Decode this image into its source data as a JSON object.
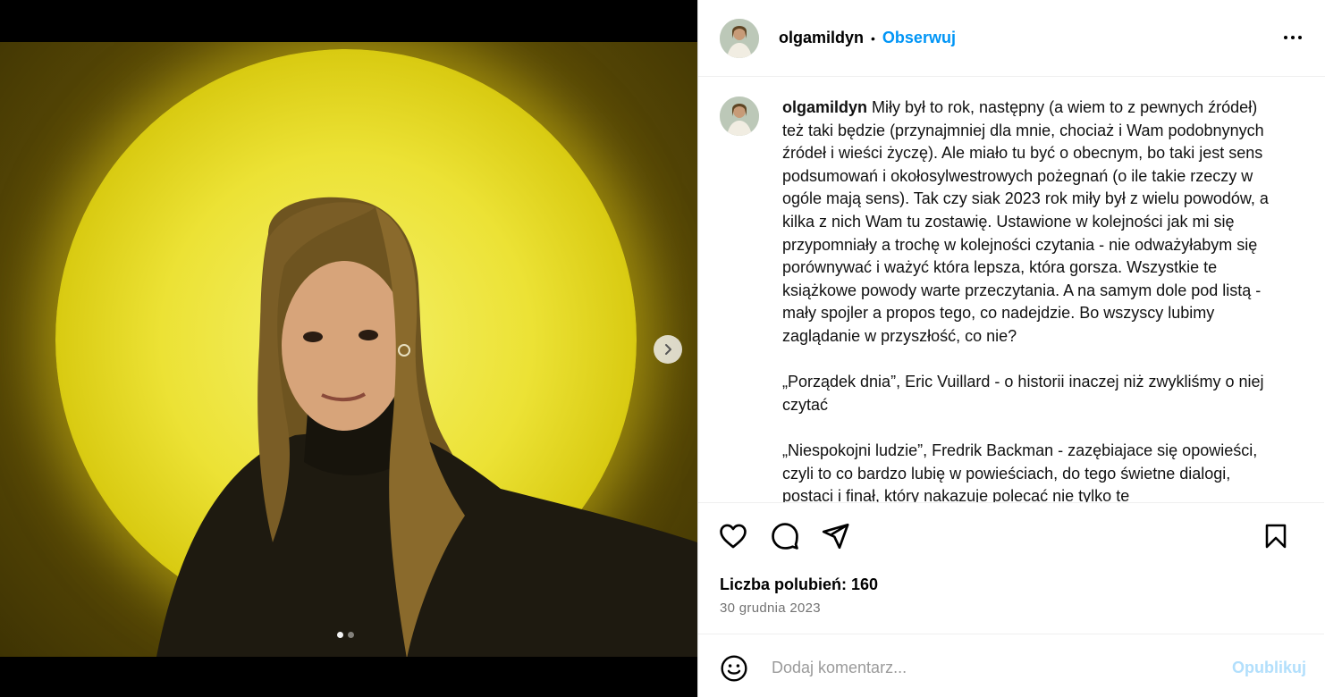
{
  "post": {
    "username": "olgamildyn",
    "separator": "•",
    "follow_label": "Obserwuj",
    "caption": {
      "username": "olgamildyn",
      "text": " Miły był to rok, następny (a wiem to z pewnych źródeł) też taki będzie (przynajmniej dla mnie, chociaż i Wam podobnynych źródeł i wieści życzę). Ale miało tu być o obecnym, bo taki jest sens podsumowań i okołosylwestrowych pożegnań (o ile takie rzeczy w ogóle mają sens). Tak czy siak 2023 rok miły był z wielu powodów, a kilka z nich Wam tu zostawię. Ustawione w kolejności jak mi się przypomniały a trochę w kolejności czytania - nie odważyłabym się porównywać i ważyć która lepsza, która gorsza. Wszystkie te książkowe powody warte przeczytania. A na samym dole pod listą - mały spojler a propos tego, co nadejdzie. Bo wszyscy lubimy zaglądanie w przyszłość, co nie?\n\n„Porządek dnia”, Eric Vuillard - o historii inaczej niż zwykliśmy o niej czytać\n\n„Niespokojni ludzie”, Fredrik Backman - zazębiajace się opowieści, czyli to co bardzo lubię w powieściach, do tego świetne dialogi, postaci i finał, który nakazuje polecać nie tylko te"
    },
    "likes_label": "Liczba polubień: 160",
    "date": "30 grudnia 2023",
    "comment_placeholder": "Dodaj komentarz...",
    "publish_label": "Opublikuj"
  },
  "carousel": {
    "current": 1,
    "total": 2
  },
  "icons": {
    "more": "more-horizontal-icon",
    "like": "heart-icon",
    "comment": "comment-bubble-icon",
    "share": "paper-plane-icon",
    "save": "bookmark-icon",
    "emoji": "smiley-icon",
    "next": "chevron-right-icon"
  },
  "colors": {
    "accent": "#0095f6",
    "publish_disabled": "#b2dffc",
    "muted": "#737373"
  }
}
